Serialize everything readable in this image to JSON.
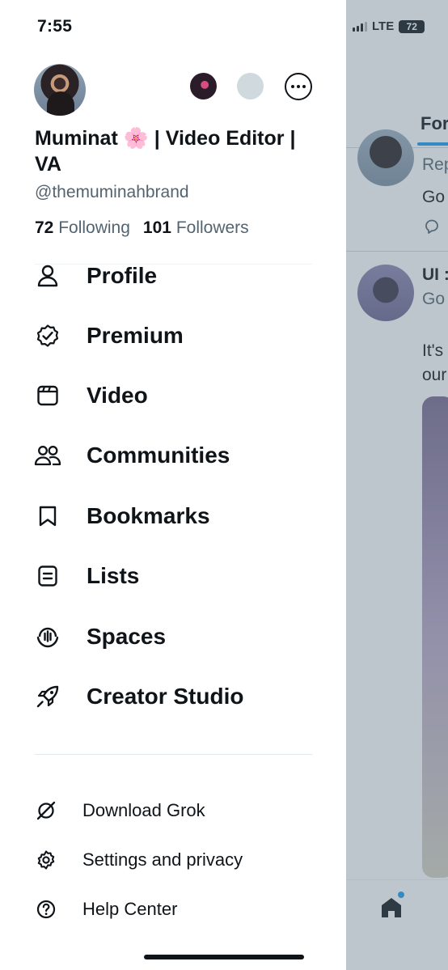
{
  "status_bar": {
    "time": "7:55",
    "network": "LTE",
    "battery": "72"
  },
  "profile": {
    "display_name": "Muminat 🌸 | Video Editor | VA",
    "handle": "@themuminahbrand",
    "following_count": "72",
    "following_label": "Following",
    "followers_count": "101",
    "followers_label": "Followers"
  },
  "menu": [
    {
      "label": "Profile",
      "icon": "person-icon"
    },
    {
      "label": "Premium",
      "icon": "verified-badge-icon"
    },
    {
      "label": "Video",
      "icon": "video-icon"
    },
    {
      "label": "Communities",
      "icon": "communities-icon"
    },
    {
      "label": "Bookmarks",
      "icon": "bookmark-icon"
    },
    {
      "label": "Lists",
      "icon": "list-icon"
    },
    {
      "label": "Spaces",
      "icon": "spaces-icon"
    },
    {
      "label": "Creator Studio",
      "icon": "rocket-icon"
    }
  ],
  "secondary_menu": [
    {
      "label": "Download Grok",
      "icon": "grok-icon"
    },
    {
      "label": "Settings and privacy",
      "icon": "gear-icon"
    },
    {
      "label": "Help Center",
      "icon": "help-icon"
    }
  ],
  "timeline": {
    "tab": "For",
    "tweets": [
      {
        "line1": "Rep",
        "line2": "Go"
      },
      {
        "author": "UI :",
        "line1": "Go",
        "line2": "It's",
        "line3": "our"
      }
    ]
  },
  "colors": {
    "accent": "#1d9bf0",
    "text": "#0f1419",
    "secondary": "#536471"
  }
}
